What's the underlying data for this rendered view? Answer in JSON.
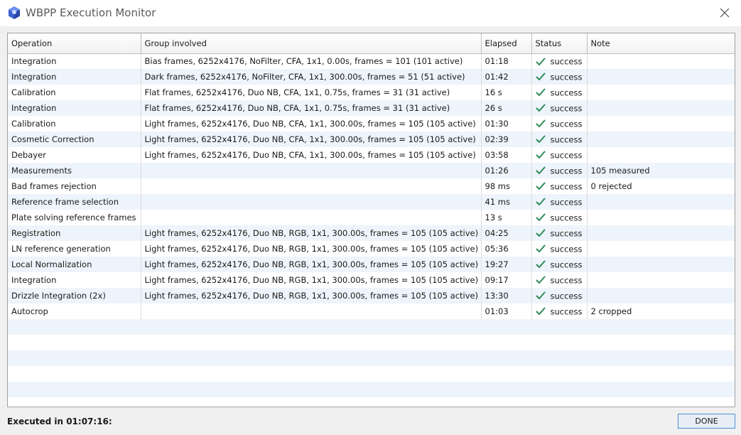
{
  "window": {
    "title": "WBPP Execution Monitor",
    "close_icon": "close-icon",
    "app_icon": "pixinsight-logo-icon"
  },
  "table": {
    "columns": [
      "Operation",
      "Group involved",
      "Elapsed",
      "Status",
      "Note"
    ],
    "rows": [
      {
        "operation": "Integration",
        "group": "Bias frames, 6252x4176, NoFilter, CFA, 1x1, 0.00s, frames = 101 (101 active)",
        "elapsed": "01:18",
        "status": "success",
        "note": ""
      },
      {
        "operation": "Integration",
        "group": "Dark frames, 6252x4176, NoFilter, CFA, 1x1, 300.00s, frames = 51 (51 active)",
        "elapsed": "01:42",
        "status": "success",
        "note": ""
      },
      {
        "operation": "Calibration",
        "group": "Flat frames, 6252x4176, Duo NB, CFA, 1x1, 0.75s, frames = 31 (31 active)",
        "elapsed": "16 s",
        "status": "success",
        "note": ""
      },
      {
        "operation": "Integration",
        "group": "Flat frames, 6252x4176, Duo NB, CFA, 1x1, 0.75s, frames = 31 (31 active)",
        "elapsed": "26 s",
        "status": "success",
        "note": ""
      },
      {
        "operation": "Calibration",
        "group": "Light frames, 6252x4176, Duo NB, CFA, 1x1, 300.00s, frames = 105 (105 active)",
        "elapsed": "01:30",
        "status": "success",
        "note": ""
      },
      {
        "operation": "Cosmetic Correction",
        "group": "Light frames, 6252x4176, Duo NB, CFA, 1x1, 300.00s, frames = 105 (105 active)",
        "elapsed": "02:39",
        "status": "success",
        "note": ""
      },
      {
        "operation": "Debayer",
        "group": "Light frames, 6252x4176, Duo NB, CFA, 1x1, 300.00s, frames = 105 (105 active)",
        "elapsed": "03:58",
        "status": "success",
        "note": ""
      },
      {
        "operation": "Measurements",
        "group": "",
        "elapsed": "01:26",
        "status": "success",
        "note": "105 measured"
      },
      {
        "operation": "Bad frames rejection",
        "group": "",
        "elapsed": "98 ms",
        "status": "success",
        "note": "0 rejected"
      },
      {
        "operation": "Reference frame selection",
        "group": "",
        "elapsed": "41 ms",
        "status": "success",
        "note": ""
      },
      {
        "operation": "Plate solving reference frames",
        "group": "",
        "elapsed": "13 s",
        "status": "success",
        "note": ""
      },
      {
        "operation": "Registration",
        "group": "Light frames, 6252x4176, Duo NB, RGB, 1x1, 300.00s, frames = 105 (105 active)",
        "elapsed": "04:25",
        "status": "success",
        "note": ""
      },
      {
        "operation": "LN reference generation",
        "group": "Light frames, 6252x4176, Duo NB, RGB, 1x1, 300.00s, frames = 105 (105 active)",
        "elapsed": "05:36",
        "status": "success",
        "note": ""
      },
      {
        "operation": "Local Normalization",
        "group": "Light frames, 6252x4176, Duo NB, RGB, 1x1, 300.00s, frames = 105 (105 active)",
        "elapsed": "19:27",
        "status": "success",
        "note": ""
      },
      {
        "operation": "Integration",
        "group": "Light frames, 6252x4176, Duo NB, RGB, 1x1, 300.00s, frames = 105 (105 active)",
        "elapsed": "09:17",
        "status": "success",
        "note": ""
      },
      {
        "operation": "Drizzle Integration (2x)",
        "group": "Light frames, 6252x4176, Duo NB, RGB, 1x1, 300.00s, frames = 105 (105 active)",
        "elapsed": "13:30",
        "status": "success",
        "note": ""
      },
      {
        "operation": "Autocrop",
        "group": "",
        "elapsed": "01:03",
        "status": "success",
        "note": "2 cropped"
      }
    ],
    "status_icon": "checkmark-icon",
    "status_color": "#2e8b57"
  },
  "footer": {
    "executed_text": "Executed in 01:07:16:",
    "done_label": "DONE"
  }
}
